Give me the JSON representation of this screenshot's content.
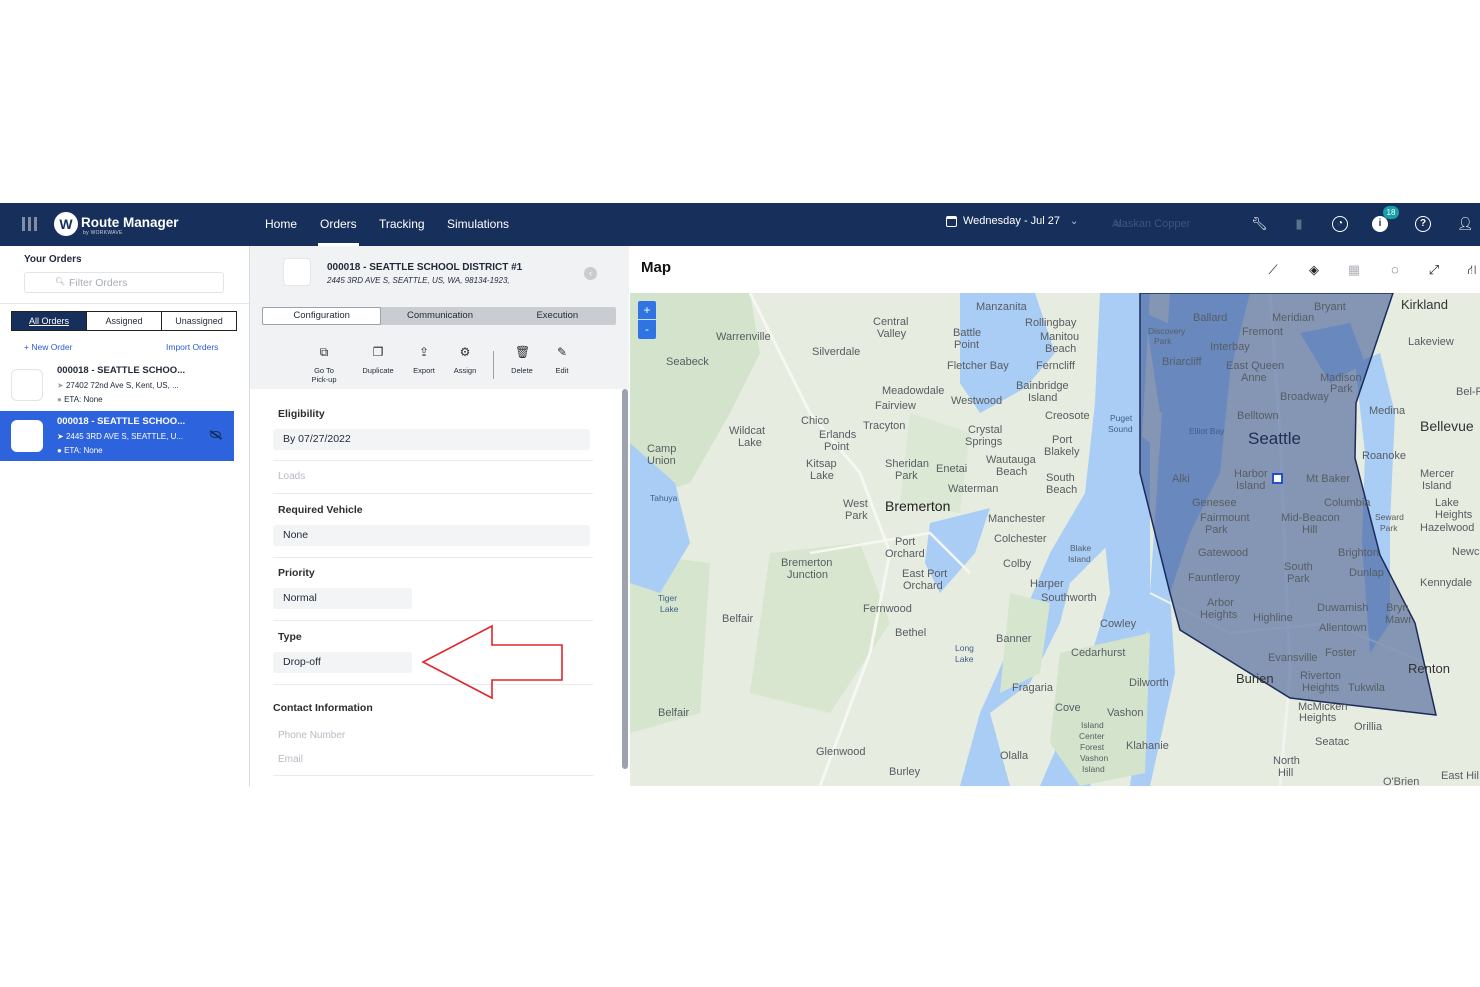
{
  "app": {
    "brand_mark": "W",
    "brand": "Route Manager",
    "brand_sub": "by WORKWAVE",
    "nav": [
      "Home",
      "Orders",
      "Tracking",
      "Simulations"
    ],
    "active_nav": "Orders",
    "date": "Wednesday - Jul 27",
    "company": "Alaskan Copper",
    "notification_count": "18",
    "accent": "#17305b"
  },
  "sidebar": {
    "title": "Your Orders",
    "filter_placeholder": "Filter Orders",
    "filter_tabs": [
      "All Orders",
      "Assigned",
      "Unassigned"
    ],
    "new_order": "+ New Order",
    "import_orders": "Import Orders",
    "orders": [
      {
        "title": "000018 - SEATTLE SCHOO...",
        "address": "27402 72nd Ave S, Kent, US, ...",
        "eta": "ETA: None",
        "selected": false
      },
      {
        "title": "000018 - SEATTLE SCHOO...",
        "address": "2445 3RD AVE S, SEATTLE, U...",
        "eta": "ETA: None",
        "selected": true
      }
    ]
  },
  "detail": {
    "title": "000018 - SEATTLE SCHOOL DISTRICT #1",
    "address": "2445 3RD AVE S, SEATTLE, US, WA, 98134-1923,",
    "tabs": [
      "Configuration",
      "Communication",
      "Execution"
    ],
    "active_tab": "Configuration",
    "actions": {
      "go_to_pickup_1": "Go To",
      "go_to_pickup_2": "Pick-up",
      "duplicate": "Duplicate",
      "export": "Export",
      "assign": "Assign",
      "delete": "Delete",
      "edit": "Edit"
    },
    "eligibility_label": "Eligibility",
    "eligibility_value": "By 07/27/2022",
    "loads_label": "Loads",
    "required_vehicle_label": "Required Vehicle",
    "required_vehicle_value": "None",
    "priority_label": "Priority",
    "priority_value": "Normal",
    "type_label": "Type",
    "type_value": "Drop-off",
    "contact_label": "Contact Information",
    "phone_label": "Phone Number",
    "email_label": "Email"
  },
  "map": {
    "title": "Map",
    "zoom_in": "+",
    "zoom_out": "-",
    "labels": {
      "manzanita": "Manzanita",
      "rollingbay": "Rollingbay",
      "manitou": "Manitou",
      "beach": "Beach",
      "central": "Central",
      "valley": "Valley",
      "battle": "Battle",
      "point": "Point",
      "warrenville": "Warrenville",
      "silverdale": "Silverdale",
      "seabeck": "Seabeck",
      "fletcher_bay": "Fletcher Bay",
      "ferncliff": "Ferncliff",
      "bainbridge": "Bainbridge",
      "island": "Island",
      "meadowdale": "Meadowdale",
      "westwood": "Westwood",
      "fairview": "Fairview",
      "creosote": "Creosote",
      "puget": "Puget",
      "sound": "Sound",
      "chico": "Chico",
      "tracyton": "Tracyton",
      "erlands": "Erlands",
      "wildcat": "Wildcat",
      "lake": "Lake",
      "crystal": "Crystal",
      "springs": "Springs",
      "port": "Port",
      "blakely": "Blakely",
      "camp": "Camp",
      "union": "Union",
      "kitsap": "Kitsap",
      "sheridan": "Sheridan",
      "park": "Park",
      "enetai": "Enetai",
      "wautauga": "Wautauga",
      "south": "South",
      "tahuya": "Tahuya",
      "waterman": "Waterman",
      "west": "West",
      "bremerton": "Bremerton",
      "manchester": "Manchester",
      "orchard": "Orchard",
      "colchester": "Colchester",
      "bremerton_junction": "Bremerton",
      "junction": "Junction",
      "east_port": "East Port",
      "colby": "Colby",
      "blake": "Blake",
      "harper": "Harper",
      "southworth": "Southworth",
      "tiger": "Tiger",
      "belfair": "Belfair",
      "fernwood": "Fernwood",
      "bethel": "Bethel",
      "banner": "Banner",
      "cowley": "Cowley",
      "long": "Long",
      "cedarhurst": "Cedarhurst",
      "fragaria": "Fragaria",
      "dilworth": "Dilworth",
      "cove": "Cove",
      "vashon": "Vashon",
      "island_center": "Island",
      "center": "Center",
      "forest": "Forest",
      "klahanie": "Klahanie",
      "glenwood": "Glenwood",
      "olalla": "Olalla",
      "burley": "Burley",
      "bryant": "Bryant",
      "kirkland": "Kirkland",
      "ballard": "Ballard",
      "meridian": "Meridian",
      "discovery": "Discovery",
      "fremont": "Fremont",
      "lakeview": "Lakeview",
      "interbay": "Interbay",
      "briarcliff": "Briarcliff",
      "east_queen": "East Queen",
      "anne": "Anne",
      "madison": "Madison",
      "broadway": "Broadway",
      "bel_red": "Bel-R",
      "belltown": "Belltown",
      "medina": "Medina",
      "elliott_bay": "Elliot Bay",
      "seattle": "Seattle",
      "bellevue": "Bellevue",
      "roanoke": "Roanoke",
      "harbor": "Harbor",
      "mt_baker": "Mt Baker",
      "alki": "Alki",
      "mercer": "Mercer",
      "genesee": "Genesee",
      "columbia": "Columbia",
      "fairmount": "Fairmount",
      "mid_beacon": "Mid-Beacon",
      "hill": "Hill",
      "lake_heights": "Lake",
      "heights": "Heights",
      "hazelwood": "Hazelwood",
      "gatewood": "Gatewood",
      "brighton": "Brighton",
      "newca": "Newca",
      "dunlap": "Dunlap",
      "fauntleroy": "Fauntleroy",
      "kennydale": "Kennydale",
      "arbor": "Arbor",
      "duwamish": "Duwamish",
      "bryn": "Bryn",
      "mawr": "Mawr",
      "highline": "Highline",
      "allentown": "Allentown",
      "foster": "Foster",
      "evansville": "Evansville",
      "renton": "Renton",
      "burien": "Burien",
      "riverton": "Riverton",
      "tukwila": "Tukwila",
      "mcmicken": "McMicken",
      "orillia": "Orillia",
      "seatac": "Seatac",
      "north": "North",
      "obrien": "O'Brien",
      "east_hill": "East Hil",
      "seward": "Seward",
      "elliot": "Elliot Bay"
    }
  }
}
